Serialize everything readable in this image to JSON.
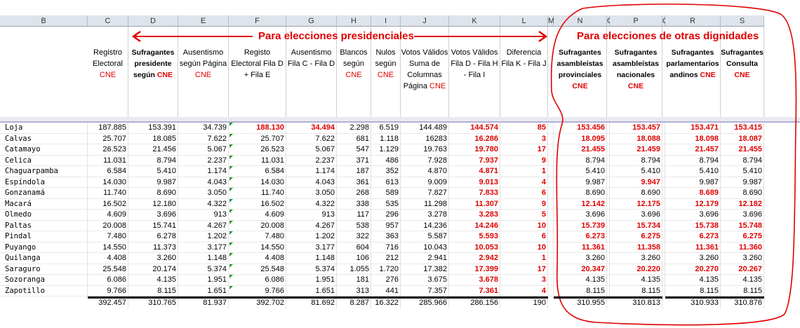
{
  "colors": {
    "accent_red": "#e00000",
    "header_bg": "#dfe4ec",
    "fill_marker": "#1e9a3a"
  },
  "column_letters": [
    "B",
    "C",
    "D",
    "E",
    "F",
    "G",
    "H",
    "I",
    "J",
    "K",
    "L",
    "M",
    "N",
    "O",
    "P",
    "Q",
    "R",
    "S"
  ],
  "headers": {
    "C": {
      "text": "Registro Electoral",
      "cne": "CNE"
    },
    "D": {
      "text": "Sufragantes presidente según",
      "cne": "CNE"
    },
    "E": {
      "text": "Ausentismo según Página",
      "cne": "CNE"
    },
    "F": {
      "text": "Registo Electoral Fila D + Fila E",
      "cne": ""
    },
    "G": {
      "text": "Ausentismo Fila C - Fila D",
      "cne": ""
    },
    "H": {
      "text": "Blancos según",
      "cne": "CNE"
    },
    "I": {
      "text": "Nulos según",
      "cne": "CNE"
    },
    "J": {
      "text": "Votos Válidos Suma de Columnas Página",
      "cne": "CNE"
    },
    "K": {
      "text": "Votos Válidos Fila D - Fila H - Fila I",
      "cne": ""
    },
    "L": {
      "text": "Diferencia Fila K - Fila J",
      "cne": ""
    },
    "N": {
      "text": "Sufragantes asambleístas provinciales",
      "cne": "CNE"
    },
    "P": {
      "text": "Sufragantes asambleístas nacionales",
      "cne": "CNE"
    },
    "R": {
      "text": "Sufragantes parlamentarios andinos",
      "cne": "CNE"
    },
    "S": {
      "text": "Sufragantes Consulta",
      "cne": "CNE"
    }
  },
  "annotations": {
    "presidential": "Para elecciones presidenciales",
    "others": "Para elecciones de otras dignidades"
  },
  "rows": [
    {
      "name": "Loja",
      "C": "187.885",
      "D": "153.391",
      "E": "34.739",
      "F": "188.130",
      "G": "34.494",
      "H": "2.298",
      "I": "6.519",
      "J": "144.489",
      "K": "144.574",
      "L": "85",
      "N": "153.456",
      "P": "153.457",
      "R": "153.471",
      "S": "153.415"
    },
    {
      "name": "Calvas",
      "C": "25.707",
      "D": "18.085",
      "E": "7.622",
      "F": "25.707",
      "G": "7.622",
      "H": "681",
      "I": "1.118",
      "J": "16283",
      "K": "16.286",
      "L": "3",
      "N": "18.095",
      "P": "18.088",
      "R": "18.098",
      "S": "18.087"
    },
    {
      "name": "Catamayo",
      "C": "26.523",
      "D": "21.456",
      "E": "5.067",
      "F": "26.523",
      "G": "5.067",
      "H": "547",
      "I": "1.129",
      "J": "19.763",
      "K": "19.780",
      "L": "17",
      "N": "21.455",
      "P": "21.459",
      "R": "21.457",
      "S": "21.455"
    },
    {
      "name": "Celica",
      "C": "11.031",
      "D": "8.794",
      "E": "2.237",
      "F": "11.031",
      "G": "2.237",
      "H": "371",
      "I": "486",
      "J": "7.928",
      "K": "7.937",
      "L": "9",
      "N": "8.794",
      "P": "8.794",
      "R": "8.794",
      "S": "8.794"
    },
    {
      "name": "Chaguarpamba",
      "C": "6.584",
      "D": "5.410",
      "E": "1.174",
      "F": "6.584",
      "G": "1.174",
      "H": "187",
      "I": "352",
      "J": "4.870",
      "K": "4.871",
      "L": "1",
      "N": "5.410",
      "P": "5.410",
      "R": "5.410",
      "S": "5.410"
    },
    {
      "name": "Espíndola",
      "C": "14.030",
      "D": "9.987",
      "E": "4.043",
      "F": "14.030",
      "G": "4.043",
      "H": "361",
      "I": "613",
      "J": "9.009",
      "K": "9.013",
      "L": "4",
      "N": "9.987",
      "P": "9.947",
      "R": "9.987",
      "S": "9.987"
    },
    {
      "name": "Gonzanamá",
      "C": "11.740",
      "D": "8.690",
      "E": "3.050",
      "F": "11.740",
      "G": "3.050",
      "H": "268",
      "I": "589",
      "J": "7.827",
      "K": "7.833",
      "L": "6",
      "N": "8.690",
      "P": "8.690",
      "R": "8.689",
      "S": "8.690"
    },
    {
      "name": "Macará",
      "C": "16.502",
      "D": "12.180",
      "E": "4.322",
      "F": "16.502",
      "G": "4.322",
      "H": "338",
      "I": "535",
      "J": "11.298",
      "K": "11.307",
      "L": "9",
      "N": "12.142",
      "P": "12.175",
      "R": "12.179",
      "S": "12.182"
    },
    {
      "name": "Olmedo",
      "C": "4.609",
      "D": "3.696",
      "E": "913",
      "F": "4.609",
      "G": "913",
      "H": "117",
      "I": "296",
      "J": "3.278",
      "K": "3.283",
      "L": "5",
      "N": "3.696",
      "P": "3.696",
      "R": "3.696",
      "S": "3.696"
    },
    {
      "name": "Paltas",
      "C": "20.008",
      "D": "15.741",
      "E": "4.267",
      "F": "20.008",
      "G": "4.267",
      "H": "538",
      "I": "957",
      "J": "14.236",
      "K": "14.246",
      "L": "10",
      "N": "15.739",
      "P": "15.734",
      "R": "15.738",
      "S": "15.748"
    },
    {
      "name": "Pindal",
      "C": "7.480",
      "D": "6.278",
      "E": "1.202",
      "F": "7.480",
      "G": "1.202",
      "H": "322",
      "I": "363",
      "J": "5.587",
      "K": "5.593",
      "L": "6",
      "N": "6.273",
      "P": "6.275",
      "R": "6.273",
      "S": "6.275"
    },
    {
      "name": "Puyango",
      "C": "14.550",
      "D": "11.373",
      "E": "3.177",
      "F": "14.550",
      "G": "3.177",
      "H": "604",
      "I": "716",
      "J": "10.043",
      "K": "10.053",
      "L": "10",
      "N": "11.361",
      "P": "11.358",
      "R": "11.361",
      "S": "11.360"
    },
    {
      "name": "Quilanga",
      "C": "4.408",
      "D": "3.260",
      "E": "1.148",
      "F": "4.408",
      "G": "1.148",
      "H": "106",
      "I": "212",
      "J": "2.941",
      "K": "2.942",
      "L": "1",
      "N": "3.260",
      "P": "3.260",
      "R": "3.260",
      "S": "3.260"
    },
    {
      "name": "Saraguro",
      "C": "25.548",
      "D": "20.174",
      "E": "5.374",
      "F": "25.548",
      "G": "5.374",
      "H": "1.055",
      "I": "1.720",
      "J": "17.382",
      "K": "17.399",
      "L": "17",
      "N": "20.347",
      "P": "20.220",
      "R": "20.270",
      "S": "20.267"
    },
    {
      "name": "Sozoranga",
      "C": "6.086",
      "D": "4.135",
      "E": "1.951",
      "F": "6.086",
      "G": "1.951",
      "H": "181",
      "I": "276",
      "J": "3.675",
      "K": "3.678",
      "L": "3",
      "N": "4.135",
      "P": "4.135",
      "R": "4.135",
      "S": "4.135"
    },
    {
      "name": "Zapotillo",
      "C": "9.766",
      "D": "8.115",
      "E": "1.651",
      "F": "9.766",
      "G": "1.651",
      "H": "313",
      "I": "441",
      "J": "7.357",
      "K": "7.361",
      "L": "4",
      "N": "8.115",
      "P": "8.115",
      "R": "8.115",
      "S": "8.115"
    }
  ],
  "totals": {
    "C": "392.457",
    "D": "310.765",
    "E": "81.937",
    "F": "392.702",
    "G": "81.692",
    "H": "8.287",
    "I": "16.322",
    "J": "285.966",
    "K": "286.156",
    "L": "190",
    "N": "310.955",
    "P": "310.813",
    "R": "310.933",
    "S": "310.876"
  }
}
